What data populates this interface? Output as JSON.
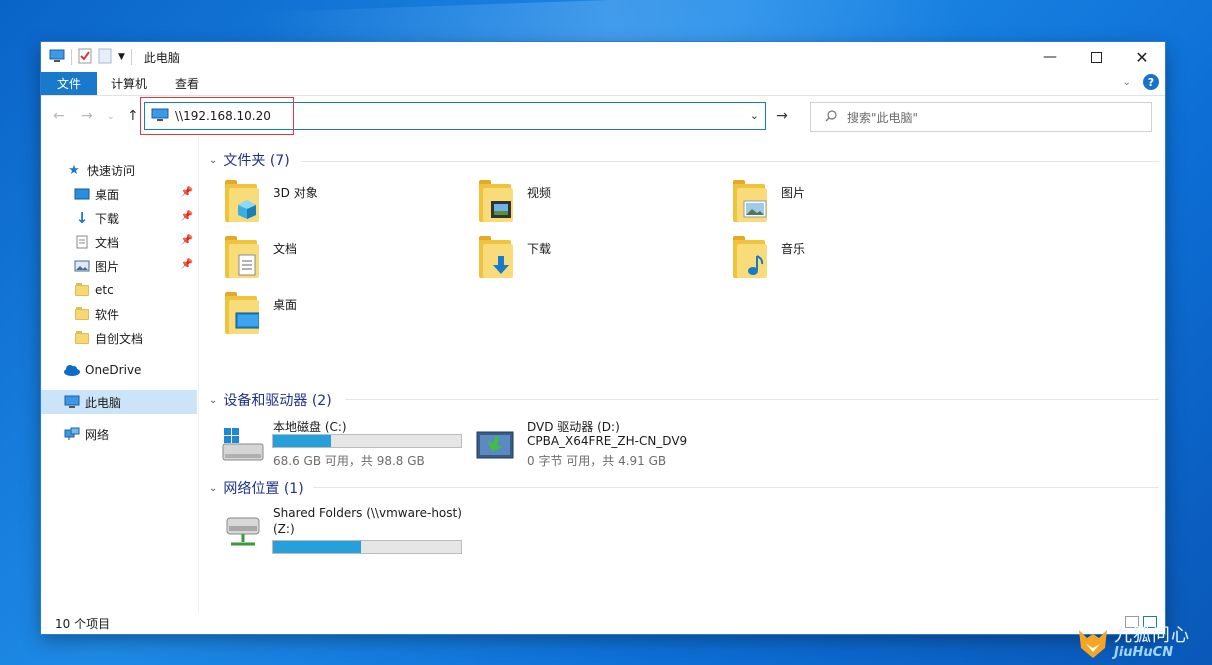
{
  "window": {
    "title": "此电脑"
  },
  "ribbon": {
    "tabs": [
      "文件",
      "计算机",
      "查看"
    ]
  },
  "nav": {
    "address": "\\\\192.168.10.20",
    "search_placeholder": "搜索\"此电脑\""
  },
  "sidebar": {
    "items": [
      {
        "label": "快速访问",
        "icon": "star-icon"
      },
      {
        "label": "桌面",
        "icon": "desktop-icon",
        "pinned": true
      },
      {
        "label": "下载",
        "icon": "download-icon",
        "pinned": true
      },
      {
        "label": "文档",
        "icon": "document-icon",
        "pinned": true
      },
      {
        "label": "图片",
        "icon": "pictures-icon",
        "pinned": true
      },
      {
        "label": "etc",
        "icon": "folder-icon"
      },
      {
        "label": "软件",
        "icon": "folder-icon"
      },
      {
        "label": "自创文档",
        "icon": "folder-icon"
      },
      {
        "label": "OneDrive",
        "icon": "cloud-icon"
      },
      {
        "label": "此电脑",
        "icon": "pc-icon",
        "selected": true
      },
      {
        "label": "网络",
        "icon": "network-icon"
      }
    ]
  },
  "groups": {
    "folders": {
      "header": "文件夹 (7)",
      "items": [
        "3D 对象",
        "视频",
        "图片",
        "文档",
        "下载",
        "音乐",
        "桌面"
      ]
    },
    "devices": {
      "header": "设备和驱动器 (2)",
      "items": [
        {
          "name": "本地磁盘 (C:)",
          "sub": "68.6 GB 可用，共 98.8 GB",
          "used_fraction": 0.31
        },
        {
          "name": "DVD 驱动器 (D:)",
          "name2": "CPBA_X64FRE_ZH-CN_DV9",
          "sub": "0 字节 可用，共 4.91 GB"
        }
      ]
    },
    "network": {
      "header": "网络位置 (1)",
      "items": [
        {
          "name": "Shared Folders (\\\\vmware-host)",
          "name2": "(Z:)",
          "used_fraction": 0.47
        }
      ]
    }
  },
  "status": {
    "count": "10 个项目"
  },
  "watermark": {
    "cn": "九狐问心",
    "en": "JiuHuCN"
  },
  "colors": {
    "accent": "#1979ca",
    "bar": "#26a0da",
    "header_text": "#1e3287"
  }
}
